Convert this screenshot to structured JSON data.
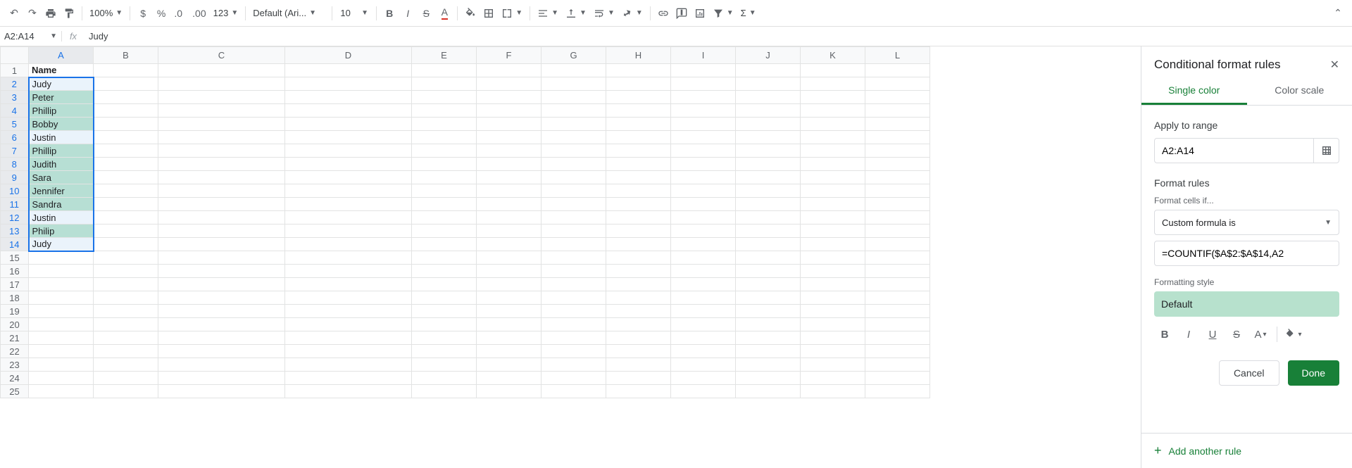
{
  "toolbar": {
    "zoom": "100%",
    "font": "Default (Ari...",
    "font_size": "10",
    "format_more": "123"
  },
  "namebox": "A2:A14",
  "fx_value": "Judy",
  "columns": [
    "A",
    "B",
    "C",
    "D",
    "E",
    "F",
    "G",
    "H",
    "I",
    "J",
    "K",
    "L"
  ],
  "row_count": 25,
  "sheet": {
    "header_cell": "Name",
    "rows": [
      {
        "v": "Judy",
        "hl": "light"
      },
      {
        "v": "Peter",
        "hl": "green"
      },
      {
        "v": "Phillip",
        "hl": "green"
      },
      {
        "v": "Bobby",
        "hl": "green"
      },
      {
        "v": "Justin",
        "hl": "light"
      },
      {
        "v": "Phillip",
        "hl": "green"
      },
      {
        "v": "Judith",
        "hl": "green"
      },
      {
        "v": "Sara",
        "hl": "green"
      },
      {
        "v": "Jennifer",
        "hl": "green"
      },
      {
        "v": "Sandra",
        "hl": "green"
      },
      {
        "v": "Justin",
        "hl": "light"
      },
      {
        "v": "Philip",
        "hl": "green"
      },
      {
        "v": "Judy",
        "hl": "light"
      }
    ]
  },
  "panel": {
    "title": "Conditional format rules",
    "tab_single": "Single color",
    "tab_scale": "Color scale",
    "apply_label": "Apply to range",
    "range_value": "A2:A14",
    "rules_label": "Format rules",
    "cells_if_label": "Format cells if...",
    "condition": "Custom formula is",
    "formula": "=COUNTIF($A$2:$A$14,A2",
    "style_label": "Formatting style",
    "style_preview": "Default",
    "cancel": "Cancel",
    "done": "Done",
    "add_rule": "Add another rule"
  }
}
